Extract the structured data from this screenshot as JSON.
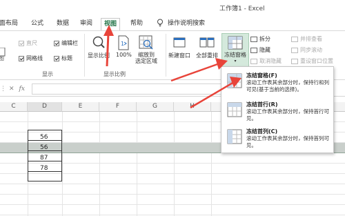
{
  "window": {
    "title": "工作簿1  -  Excel"
  },
  "tabs": [
    {
      "label": "页面布局"
    },
    {
      "label": "公式"
    },
    {
      "label": "数据"
    },
    {
      "label": "审阅"
    },
    {
      "label": "视图"
    },
    {
      "label": "帮助"
    },
    {
      "label": "操作说明搜索"
    }
  ],
  "ribbon": {
    "show_group": {
      "label": "显示",
      "ruler": "直尺",
      "gridlines": "网格线",
      "formula_bar": "编辑栏",
      "headings": "标题"
    },
    "zoom_group": {
      "label": "显示比例",
      "zoom": "显示比例",
      "zoom100": "100%",
      "zoom_to_selection_line1": "缩放到",
      "zoom_to_selection_line2": "选定区域"
    },
    "window_group": {
      "new_window": "新建窗口",
      "arrange_all": "全部重排",
      "freeze_panes": "冻结窗格",
      "split": "拆分",
      "hide": "隐藏",
      "unhide": "取消隐藏",
      "view_side_by_side": "并排查看",
      "sync_scroll": "同步滚动",
      "reset_position": "重设窗口位置"
    }
  },
  "formula_bar": {
    "fx": "fx"
  },
  "grid": {
    "columns": [
      "C",
      "D",
      "E",
      "F",
      "G",
      "H"
    ],
    "values": [
      "56",
      "56",
      "87",
      "78"
    ]
  },
  "freeze_menu": [
    {
      "title": "冻结窗格(F)",
      "desc": "滚动工作表其余部分时，保持行和列可见(基于当前的选择)。"
    },
    {
      "title": "冻结首行(R)",
      "desc": "滚动工作表其余部分时，保持首行可见。"
    },
    {
      "title": "冻结首列(C)",
      "desc": "滚动工作表其余部分时，保持首列可见。"
    }
  ],
  "colors": {
    "accent": "#217346",
    "annotation_arrow": "#e8443a"
  }
}
